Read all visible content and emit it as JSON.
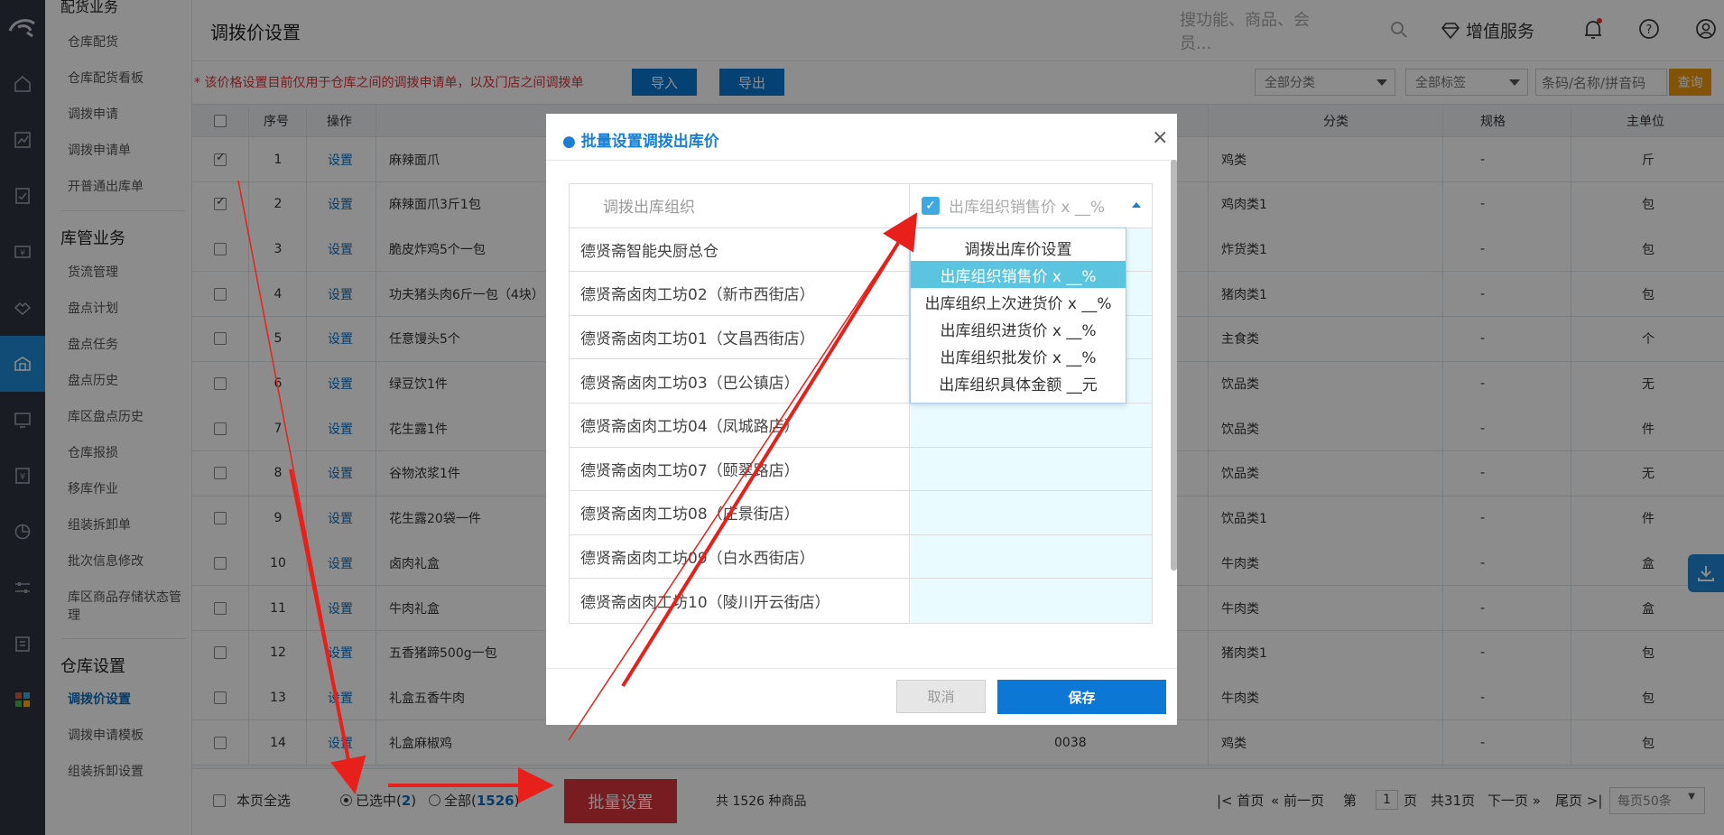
{
  "sidebar": {
    "top_partial": "配货业务",
    "group1_items": [
      "仓库配货",
      "仓库配货看板",
      "调拨申请",
      "调拨申请单",
      "开普通出库单"
    ],
    "group2_title": "库管业务",
    "group2_items": [
      "货流管理",
      "盘点计划",
      "盘点任务",
      "盘点历史",
      "库区盘点历史",
      "仓库报损",
      "移库作业",
      "组装拆卸单",
      "批次信息修改",
      "库区商品存储状态管理"
    ],
    "group3_title": "仓库设置",
    "group3_items": [
      "调拨价设置",
      "调拨申请模板",
      "组装拆卸设置"
    ]
  },
  "header": {
    "title": "调拨价设置",
    "search_placeholder": "搜功能、商品、会员...",
    "service": "增值服务"
  },
  "toolbar": {
    "note": "* 该价格设置目前仅用于仓库之间的调拨申请单，以及门店之间调拨单",
    "import": "导入",
    "export": "导出",
    "category": "全部分类",
    "tag": "全部标签",
    "query_placeholder": "条码/名称/拼音码",
    "query": "查询"
  },
  "table": {
    "headers": {
      "seq": "序号",
      "op": "操作",
      "category": "分类",
      "spec": "规格",
      "unit": "主单位"
    },
    "rows": [
      {
        "no": "1",
        "op": "设置",
        "name": "麻辣面爪",
        "code": "",
        "cat": "鸡类",
        "spec": "-",
        "unit": "斤",
        "checked": true
      },
      {
        "no": "2",
        "op": "设置",
        "name": "麻辣面爪3斤1包",
        "code": "",
        "cat": "鸡肉类1",
        "spec": "-",
        "unit": "包",
        "checked": true
      },
      {
        "no": "3",
        "op": "设置",
        "name": "脆皮炸鸡5个一包",
        "code": "",
        "cat": "炸货类1",
        "spec": "-",
        "unit": "包",
        "checked": false
      },
      {
        "no": "4",
        "op": "设置",
        "name": "功夫猪头肉6斤一包（4块）",
        "code": "",
        "cat": "猪肉类1",
        "spec": "-",
        "unit": "包",
        "checked": false
      },
      {
        "no": "5",
        "op": "设置",
        "name": "任意馒头5个",
        "code": "",
        "cat": "主食类",
        "spec": "-",
        "unit": "个",
        "checked": false
      },
      {
        "no": "6",
        "op": "设置",
        "name": "绿豆饮1件",
        "code": "",
        "cat": "饮品类",
        "spec": "-",
        "unit": "无",
        "checked": false
      },
      {
        "no": "7",
        "op": "设置",
        "name": "花生露1件",
        "code": "",
        "cat": "饮品类",
        "spec": "-",
        "unit": "件",
        "checked": false
      },
      {
        "no": "8",
        "op": "设置",
        "name": "谷物浓浆1件",
        "code": "",
        "cat": "饮品类",
        "spec": "-",
        "unit": "无",
        "checked": false
      },
      {
        "no": "9",
        "op": "设置",
        "name": "花生露20袋一件",
        "code": "",
        "cat": "饮品类1",
        "spec": "-",
        "unit": "件",
        "checked": false
      },
      {
        "no": "10",
        "op": "设置",
        "name": "卤肉礼盒",
        "code": "",
        "cat": "牛肉类",
        "spec": "-",
        "unit": "盒",
        "checked": false
      },
      {
        "no": "11",
        "op": "设置",
        "name": "牛肉礼盒",
        "code": "",
        "cat": "牛肉类",
        "spec": "-",
        "unit": "盒",
        "checked": false
      },
      {
        "no": "12",
        "op": "设置",
        "name": "五香猪蹄500g一包",
        "code": "",
        "cat": "猪肉类1",
        "spec": "-",
        "unit": "包",
        "checked": false
      },
      {
        "no": "13",
        "op": "设置",
        "name": "礼盒五香牛肉",
        "code": "",
        "cat": "牛肉类",
        "spec": "-",
        "unit": "包",
        "checked": false
      },
      {
        "no": "14",
        "op": "设置",
        "name": "礼盒麻椒鸡",
        "code": "0038",
        "cat": "鸡类",
        "spec": "-",
        "unit": "包",
        "checked": false
      }
    ]
  },
  "footer": {
    "select_page": "本页全选",
    "selected_label": "已选中(",
    "selected_count": "2",
    "all_label": "全部(",
    "all_count": "1526",
    "paren_close": ")",
    "batch": "批量设置",
    "total": "共 1526 种商品",
    "first": "首页",
    "prev": "前一页",
    "page_prefix": "第",
    "page": "1",
    "page_suffix": "页",
    "pages": "共31页",
    "next": "下一页",
    "last": "尾页",
    "per_page": "每页50条"
  },
  "dialog": {
    "title": "批量设置调拨出库价",
    "close": "×",
    "col_org": "调拨出库组织",
    "col_price": "出库组织销售价 x __%",
    "orgs": [
      "德贤斋智能央厨总仓",
      "德贤斋卤肉工坊02（新市西街店）",
      "德贤斋卤肉工坊01（文昌西街店）",
      "德贤斋卤肉工坊03（巴公镇店）",
      "德贤斋卤肉工坊04（凤城路店）",
      "德贤斋卤肉工坊07（颐翠路店）",
      "德贤斋卤肉工坊08（庄景街店）",
      "德贤斋卤肉工坊09（白水西街店）",
      "德贤斋卤肉工坊10（陵川开云街店）"
    ],
    "options": [
      "调拨出库价设置",
      "出库组织销售价 x __%",
      "出库组织上次进货价 x __%",
      "出库组织进货价 x __%",
      "出库组织批发价 x __%",
      "出库组织具体金额 __元"
    ],
    "selected_option_index": 1,
    "cancel": "取消",
    "save": "保存"
  },
  "colors": {
    "primary": "#0c77d4",
    "danger": "#d9363e",
    "query": "#ef9a10",
    "option_highlight": "#5bc4df"
  }
}
